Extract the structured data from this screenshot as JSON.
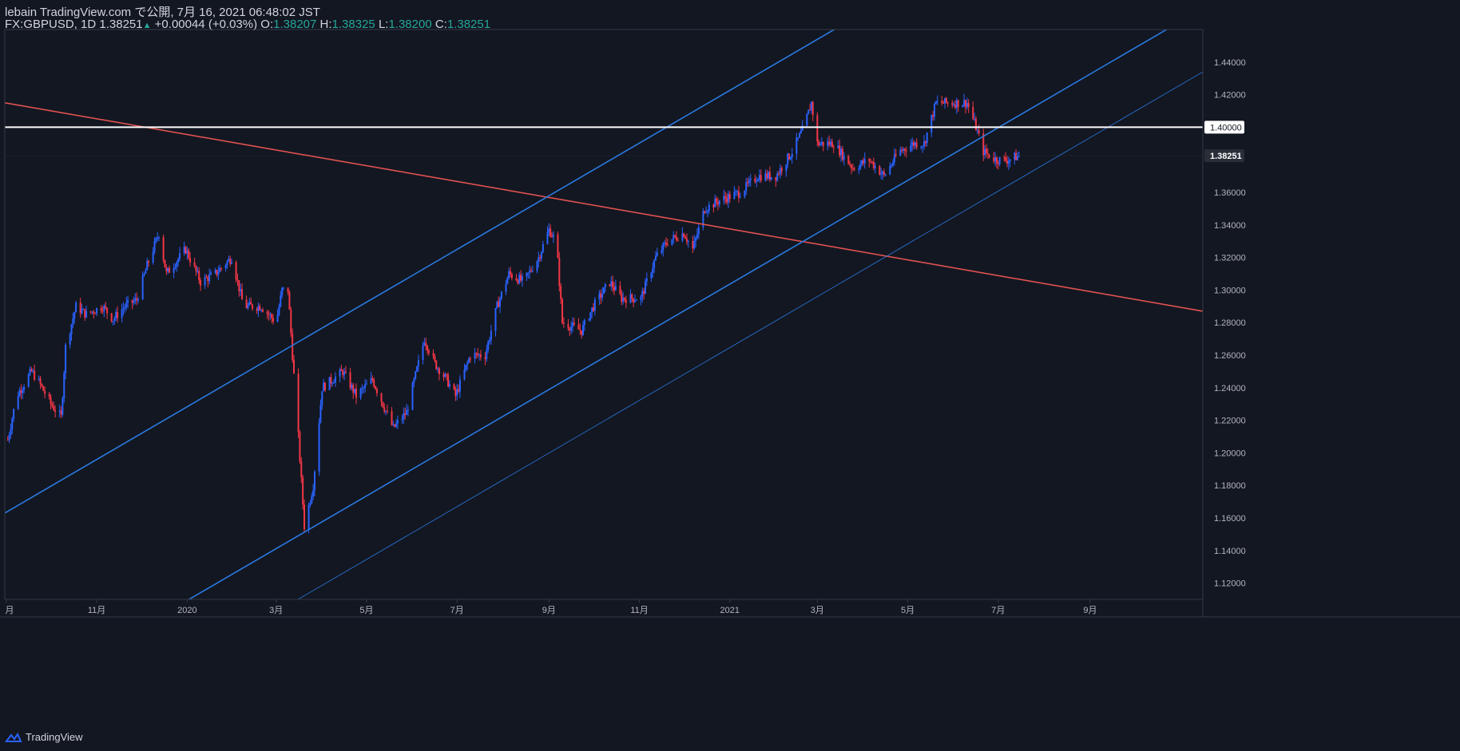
{
  "header": {
    "publisher": "lebain TradingView.com で公開, 7月 16, 2021 06:48:02 JST",
    "symbol": "FX:GBPUSD, 1D",
    "last": "1.38251",
    "change": "+0.00044 (+0.03%)",
    "o_label": "O:",
    "o_value": "1.38207",
    "h_label": "H:",
    "h_value": "1.38325",
    "l_label": "L:",
    "l_value": "1.38200",
    "c_label": "C:",
    "c_value": "1.38251"
  },
  "footer": {
    "brand": "TradingView"
  },
  "colors": {
    "background": "#131722",
    "up": "#2962ff",
    "down": "#f23645",
    "channel": "#2a79e0",
    "trendline": "#e0524f",
    "hline": "#ffffff",
    "axis_text": "#b2b5be"
  },
  "chart_data": {
    "type": "candlestick",
    "symbol": "FX:GBPUSD",
    "interval": "1D",
    "ylim": [
      1.11,
      1.46
    ],
    "y_ticks": [
      "1.44000",
      "1.42000",
      "1.40000",
      "1.38251",
      "1.36000",
      "1.34000",
      "1.32000",
      "1.30000",
      "1.28000",
      "1.26000",
      "1.24000",
      "1.22000",
      "1.20000",
      "1.18000",
      "1.16000",
      "1.14000",
      "1.12000"
    ],
    "x_ticks": [
      "月",
      "11月",
      "2020",
      "3月",
      "5月",
      "7月",
      "9月",
      "11月",
      "2021",
      "3月",
      "5月",
      "7月",
      "9月"
    ],
    "x_tick_dates": [
      "2019-09-01",
      "2019-11-01",
      "2020-01-01",
      "2020-03-01",
      "2020-05-01",
      "2020-07-01",
      "2020-09-01",
      "2020-11-01",
      "2021-01-01",
      "2021-03-01",
      "2021-05-01",
      "2021-07-01",
      "2021-09-01"
    ],
    "x_range": [
      "2019-08-31",
      "2021-11-16"
    ],
    "horizontal_line": {
      "price": 1.4,
      "label": "1.40000"
    },
    "last_price": {
      "price": 1.38251,
      "label": "1.38251"
    },
    "price_path": [
      [
        "2019-09-02",
        1.208
      ],
      [
        "2019-09-08",
        1.235
      ],
      [
        "2019-09-18",
        1.25
      ],
      [
        "2019-09-22",
        1.245
      ],
      [
        "2019-10-01",
        1.23
      ],
      [
        "2019-10-08",
        1.222
      ],
      [
        "2019-10-11",
        1.265
      ],
      [
        "2019-10-18",
        1.29
      ],
      [
        "2019-10-25",
        1.285
      ],
      [
        "2019-11-05",
        1.29
      ],
      [
        "2019-11-12",
        1.282
      ],
      [
        "2019-11-20",
        1.29
      ],
      [
        "2019-11-28",
        1.294
      ],
      [
        "2019-12-05",
        1.315
      ],
      [
        "2019-12-13",
        1.335
      ],
      [
        "2019-12-18",
        1.31
      ],
      [
        "2019-12-31",
        1.325
      ],
      [
        "2020-01-10",
        1.305
      ],
      [
        "2020-01-20",
        1.31
      ],
      [
        "2020-01-31",
        1.32
      ],
      [
        "2020-02-08",
        1.29
      ],
      [
        "2020-02-20",
        1.29
      ],
      [
        "2020-03-01",
        1.28
      ],
      [
        "2020-03-05",
        1.3
      ],
      [
        "2020-03-09",
        1.3
      ],
      [
        "2020-03-12",
        1.26
      ],
      [
        "2020-03-16",
        1.21
      ],
      [
        "2020-03-20",
        1.155
      ],
      [
        "2020-03-26",
        1.18
      ],
      [
        "2020-04-01",
        1.24
      ],
      [
        "2020-04-15",
        1.25
      ],
      [
        "2020-04-24",
        1.235
      ],
      [
        "2020-05-05",
        1.245
      ],
      [
        "2020-05-12",
        1.23
      ],
      [
        "2020-05-19",
        1.215
      ],
      [
        "2020-05-28",
        1.225
      ],
      [
        "2020-06-09",
        1.27
      ],
      [
        "2020-06-16",
        1.255
      ],
      [
        "2020-06-24",
        1.245
      ],
      [
        "2020-06-30",
        1.235
      ],
      [
        "2020-07-10",
        1.26
      ],
      [
        "2020-07-20",
        1.26
      ],
      [
        "2020-07-28",
        1.29
      ],
      [
        "2020-08-05",
        1.31
      ],
      [
        "2020-08-15",
        1.305
      ],
      [
        "2020-08-25",
        1.32
      ],
      [
        "2020-09-01",
        1.337
      ],
      [
        "2020-09-06",
        1.33
      ],
      [
        "2020-09-10",
        1.28
      ],
      [
        "2020-09-23",
        1.275
      ],
      [
        "2020-10-01",
        1.29
      ],
      [
        "2020-10-12",
        1.305
      ],
      [
        "2020-10-20",
        1.295
      ],
      [
        "2020-11-02",
        1.295
      ],
      [
        "2020-11-12",
        1.32
      ],
      [
        "2020-11-20",
        1.33
      ],
      [
        "2020-12-01",
        1.335
      ],
      [
        "2020-12-07",
        1.325
      ],
      [
        "2020-12-15",
        1.35
      ],
      [
        "2020-12-25",
        1.355
      ],
      [
        "2021-01-08",
        1.36
      ],
      [
        "2021-01-20",
        1.37
      ],
      [
        "2021-02-01",
        1.37
      ],
      [
        "2021-02-12",
        1.385
      ],
      [
        "2021-02-20",
        1.4
      ],
      [
        "2021-02-25",
        1.415
      ],
      [
        "2021-03-01",
        1.39
      ],
      [
        "2021-03-12",
        1.39
      ],
      [
        "2021-03-25",
        1.375
      ],
      [
        "2021-04-05",
        1.38
      ],
      [
        "2021-04-15",
        1.37
      ],
      [
        "2021-04-25",
        1.385
      ],
      [
        "2021-05-05",
        1.39
      ],
      [
        "2021-05-12",
        1.39
      ],
      [
        "2021-05-20",
        1.415
      ],
      [
        "2021-06-01",
        1.415
      ],
      [
        "2021-06-10",
        1.415
      ],
      [
        "2021-06-16",
        1.4
      ],
      [
        "2021-06-21",
        1.385
      ],
      [
        "2021-06-30",
        1.38
      ],
      [
        "2021-07-08",
        1.38
      ],
      [
        "2021-07-15",
        1.3825
      ]
    ],
    "drawings": [
      {
        "type": "trendline",
        "from": [
          "2019-08-31",
          1.415
        ],
        "to": [
          "2021-11-16",
          1.287
        ]
      },
      {
        "type": "channel-upper",
        "from": [
          "2019-08-31",
          1.163
        ],
        "to": [
          "2021-11-16",
          1.592
        ]
      },
      {
        "type": "channel-lower",
        "from": [
          "2019-08-31",
          1.044
        ],
        "to": [
          "2021-11-16",
          1.473
        ]
      },
      {
        "type": "channel-thin",
        "from": [
          "2019-08-31",
          1.005
        ],
        "to": [
          "2021-11-16",
          1.434
        ]
      }
    ]
  }
}
